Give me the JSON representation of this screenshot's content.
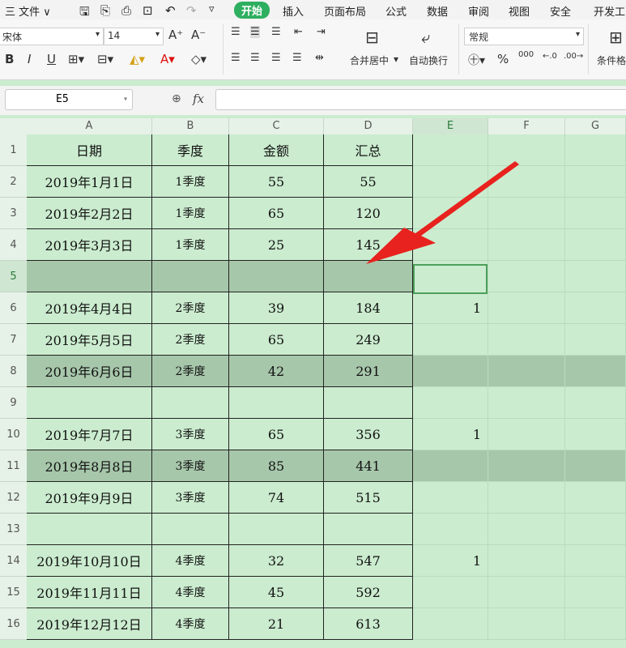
{
  "menubar": {
    "file_label": "三 文件 ∨",
    "tabs": [
      "开始",
      "插入",
      "页面布局",
      "公式",
      "数据",
      "审阅",
      "视图",
      "安全",
      "开发工"
    ]
  },
  "ribbon": {
    "font_name": "宋体",
    "font_size": "14",
    "merge_label": "合并居中",
    "wrap_label": "自动换行",
    "number_format": "常规",
    "percent": "%",
    "thousands": "000",
    "cond_format": "条件格"
  },
  "formula": {
    "name_box": "E5",
    "fx": "fx",
    "value": ""
  },
  "columns": [
    "A",
    "B",
    "C",
    "D",
    "E",
    "F",
    "G"
  ],
  "rows": [
    {
      "n": "1",
      "a": "日期",
      "b": "季度",
      "c": "金额",
      "d": "汇总",
      "e": "",
      "kind": "header"
    },
    {
      "n": "2",
      "a": "2019年1月1日",
      "b": "1季度",
      "c": "55",
      "d": "55",
      "e": ""
    },
    {
      "n": "3",
      "a": "2019年2月2日",
      "b": "1季度",
      "c": "65",
      "d": "120",
      "e": ""
    },
    {
      "n": "4",
      "a": "2019年3月3日",
      "b": "1季度",
      "c": "25",
      "d": "145",
      "e": ""
    },
    {
      "n": "5",
      "a": "",
      "b": "",
      "c": "",
      "d": "",
      "e": "",
      "kind": "blank-sel"
    },
    {
      "n": "6",
      "a": "2019年4月4日",
      "b": "2季度",
      "c": "39",
      "d": "184",
      "e": "1"
    },
    {
      "n": "7",
      "a": "2019年5月5日",
      "b": "2季度",
      "c": "65",
      "d": "249",
      "e": ""
    },
    {
      "n": "8",
      "a": "2019年6月6日",
      "b": "2季度",
      "c": "42",
      "d": "291",
      "e": "",
      "kind": "hl"
    },
    {
      "n": "9",
      "a": "",
      "b": "",
      "c": "",
      "d": "",
      "e": ""
    },
    {
      "n": "10",
      "a": "2019年7月7日",
      "b": "3季度",
      "c": "65",
      "d": "356",
      "e": "1"
    },
    {
      "n": "11",
      "a": "2019年8月8日",
      "b": "3季度",
      "c": "85",
      "d": "441",
      "e": "",
      "kind": "hl"
    },
    {
      "n": "12",
      "a": "2019年9月9日",
      "b": "3季度",
      "c": "74",
      "d": "515",
      "e": ""
    },
    {
      "n": "13",
      "a": "",
      "b": "",
      "c": "",
      "d": "",
      "e": ""
    },
    {
      "n": "14",
      "a": "2019年10月10日",
      "b": "4季度",
      "c": "32",
      "d": "547",
      "e": "1"
    },
    {
      "n": "15",
      "a": "2019年11月11日",
      "b": "4季度",
      "c": "45",
      "d": "592",
      "e": ""
    },
    {
      "n": "16",
      "a": "2019年12月12日",
      "b": "4季度",
      "c": "21",
      "d": "613",
      "e": ""
    }
  ],
  "colors": {
    "accent": "#2eaf5f",
    "sheet_bg": "#cbeccf",
    "highlight": "#a7c7ab",
    "arrow": "#e8221e"
  }
}
